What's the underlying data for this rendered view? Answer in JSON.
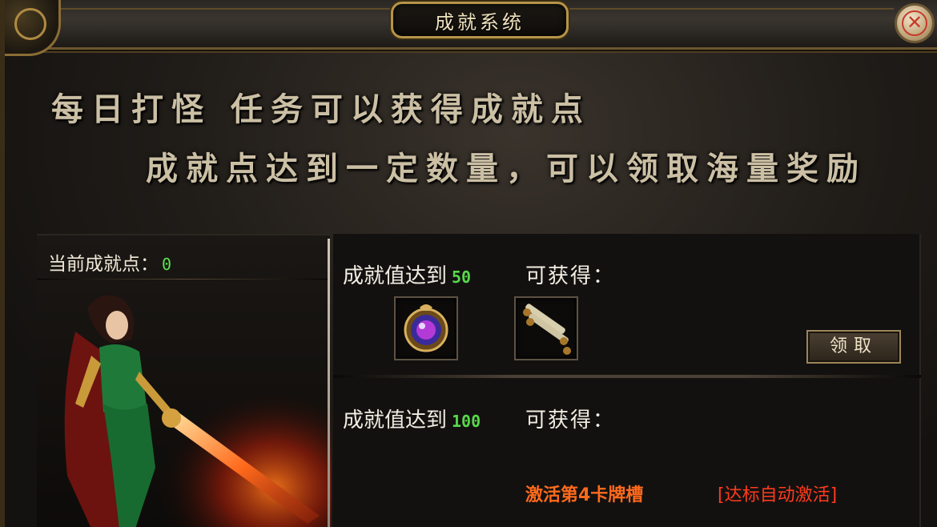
{
  "window": {
    "title": "成就系统"
  },
  "close": {
    "glyph": "✕"
  },
  "banner": {
    "line1": "每日打怪 任务可以获得成就点",
    "line2": "成就点达到一定数量，可以领取海量奖励"
  },
  "points": {
    "label": "当前成就点：",
    "value": "0"
  },
  "rewards": [
    {
      "req_label": "成就值达到",
      "req_value": "50",
      "gain_label": "可获得：",
      "claim_label": "领取"
    },
    {
      "req_label": "成就值达到",
      "req_value": "100",
      "gain_label": "可获得：",
      "slot_text": "激活第4卡牌槽",
      "auto_text": "[达标自动激活]"
    }
  ],
  "icons": {
    "item1": "orb-amulet-icon",
    "item2": "scroll-icon",
    "close": "close-icon"
  },
  "colors": {
    "accent_green": "#57d84a",
    "gold": "#b59449",
    "orange": "#ff6a1c",
    "red": "#ff3a1c"
  }
}
